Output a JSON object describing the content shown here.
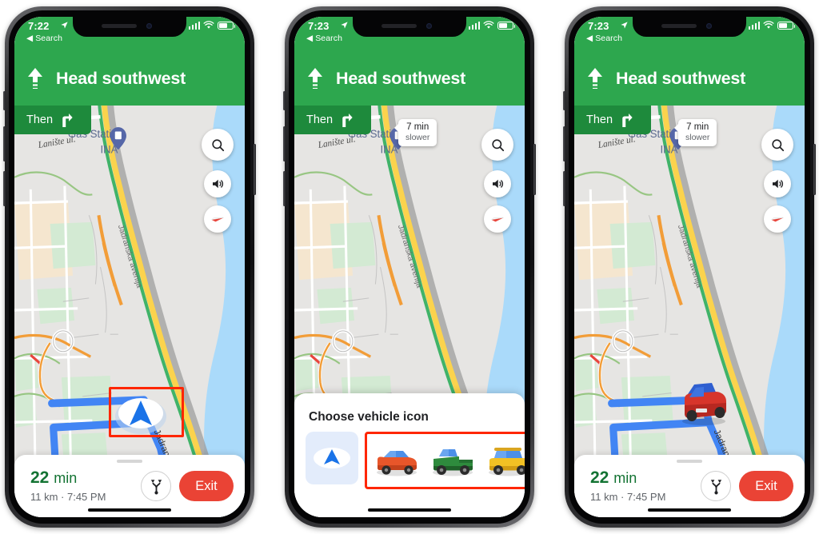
{
  "app": "Google Maps Navigation",
  "phones": [
    {
      "id": "phone-1",
      "status": {
        "time": "7:22",
        "back_label": "◀ Search",
        "location_icon": "location-arrow-icon",
        "signal_icon": "cellular-bars-icon",
        "wifi_icon": "wifi-icon",
        "battery_icon": "battery-icon"
      },
      "header": {
        "maneuver_icon": "straight-arrow-icon",
        "instruction": "Head southwest",
        "then_label": "Then",
        "then_icon": "turn-right-icon"
      },
      "controls": [
        {
          "name": "search-button",
          "icon": "search-icon"
        },
        {
          "name": "volume-button",
          "icon": "speaker-icon"
        },
        {
          "name": "compass-button",
          "icon": "compass-icon"
        }
      ],
      "map": {
        "labels": [
          "Gas Station",
          "INA",
          "Lanište ul.",
          "Jadranska aven"
        ],
        "poi_icon": "gas-station-pin-icon",
        "marker": "blue-navigation-arrow"
      },
      "slower_chip": null,
      "bottom": {
        "minutes": "22",
        "minutes_unit": "min",
        "detail": "11 km · 7:45 PM",
        "routes_icon": "route-alternatives-icon",
        "exit_label": "Exit"
      },
      "sheet": null,
      "annotation": {
        "target": "navigation-arrow-marker",
        "color": "#FF2600"
      }
    },
    {
      "id": "phone-2",
      "status": {
        "time": "7:23",
        "back_label": "◀ Search",
        "location_icon": "location-arrow-icon",
        "signal_icon": "cellular-bars-icon",
        "wifi_icon": "wifi-icon",
        "battery_icon": "battery-icon"
      },
      "header": {
        "maneuver_icon": "straight-arrow-icon",
        "instruction": "Head southwest",
        "then_label": "Then",
        "then_icon": "turn-right-icon"
      },
      "controls": [
        {
          "name": "search-button",
          "icon": "search-icon"
        },
        {
          "name": "volume-button",
          "icon": "speaker-icon"
        },
        {
          "name": "compass-button",
          "icon": "compass-icon"
        }
      ],
      "map": {
        "labels": [
          "Gas Station",
          "INA",
          "Lanište ul.",
          "Jadranska aven"
        ],
        "poi_icon": "gas-station-pin-icon",
        "marker": "blue-navigation-arrow"
      },
      "slower_chip": {
        "line1": "7 min",
        "line2": "slower"
      },
      "bottom": null,
      "sheet": {
        "title": "Choose vehicle icon",
        "options": [
          {
            "name": "arrow-option",
            "icon": "blue-navigation-arrow",
            "selected": true
          },
          {
            "name": "red-sedan-option",
            "icon": "red-car-icon",
            "selected": false
          },
          {
            "name": "green-pickup-option",
            "icon": "green-pickup-icon",
            "selected": false
          },
          {
            "name": "yellow-suv-option",
            "icon": "yellow-suv-icon",
            "selected": false
          }
        ]
      },
      "annotation": {
        "target": "vehicle-icon-row",
        "color": "#FF2600"
      }
    },
    {
      "id": "phone-3",
      "status": {
        "time": "7:23",
        "back_label": "◀ Search",
        "location_icon": "location-arrow-icon",
        "signal_icon": "cellular-bars-icon",
        "wifi_icon": "wifi-icon",
        "battery_icon": "battery-icon"
      },
      "header": {
        "maneuver_icon": "straight-arrow-icon",
        "instruction": "Head southwest",
        "then_label": "Then",
        "then_icon": "turn-right-icon"
      },
      "controls": [
        {
          "name": "search-button",
          "icon": "search-icon"
        },
        {
          "name": "volume-button",
          "icon": "speaker-icon"
        },
        {
          "name": "compass-button",
          "icon": "compass-icon"
        }
      ],
      "map": {
        "labels": [
          "Gas Station",
          "INA",
          "Lanište ul.",
          "Jadranska aven"
        ],
        "poi_icon": "gas-station-pin-icon",
        "marker": "red-car-icon"
      },
      "slower_chip": {
        "line1": "7 min",
        "line2": "slower"
      },
      "bottom": {
        "minutes": "22",
        "minutes_unit": "min",
        "detail": "11 km · 7:45 PM",
        "routes_icon": "route-alternatives-icon",
        "exit_label": "Exit"
      },
      "sheet": null,
      "annotation": null
    }
  ],
  "colors": {
    "header_green": "#2DA74E",
    "then_green": "#1E8A3C",
    "exit_red": "#EA4335",
    "eta_green": "#137333",
    "route_blue": "#4285F4",
    "annotation_red": "#FF2600",
    "map_bg": "#E6E5E3",
    "water_blue": "#AADAFA",
    "park_green": "#D3EAD3"
  }
}
